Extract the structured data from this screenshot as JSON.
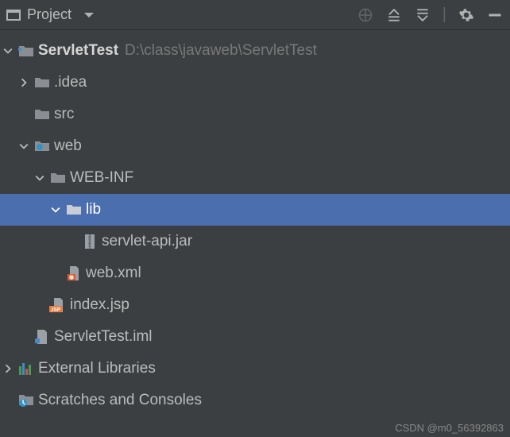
{
  "toolbar": {
    "title": "Project"
  },
  "tree": {
    "root": {
      "label": "ServletTest",
      "path": "D:\\class\\javaweb\\ServletTest"
    },
    "idea": {
      "label": ".idea"
    },
    "src": {
      "label": "src"
    },
    "web": {
      "label": "web"
    },
    "webinf": {
      "label": "WEB-INF"
    },
    "lib": {
      "label": "lib"
    },
    "jar": {
      "label": "servlet-api.jar"
    },
    "webxml": {
      "label": "web.xml"
    },
    "indexjsp": {
      "label": "index.jsp"
    },
    "iml": {
      "label": "ServletTest.iml"
    },
    "ext": {
      "label": "External Libraries"
    },
    "scratch": {
      "label": "Scratches and Consoles"
    }
  },
  "watermark": "CSDN @m0_56392863"
}
